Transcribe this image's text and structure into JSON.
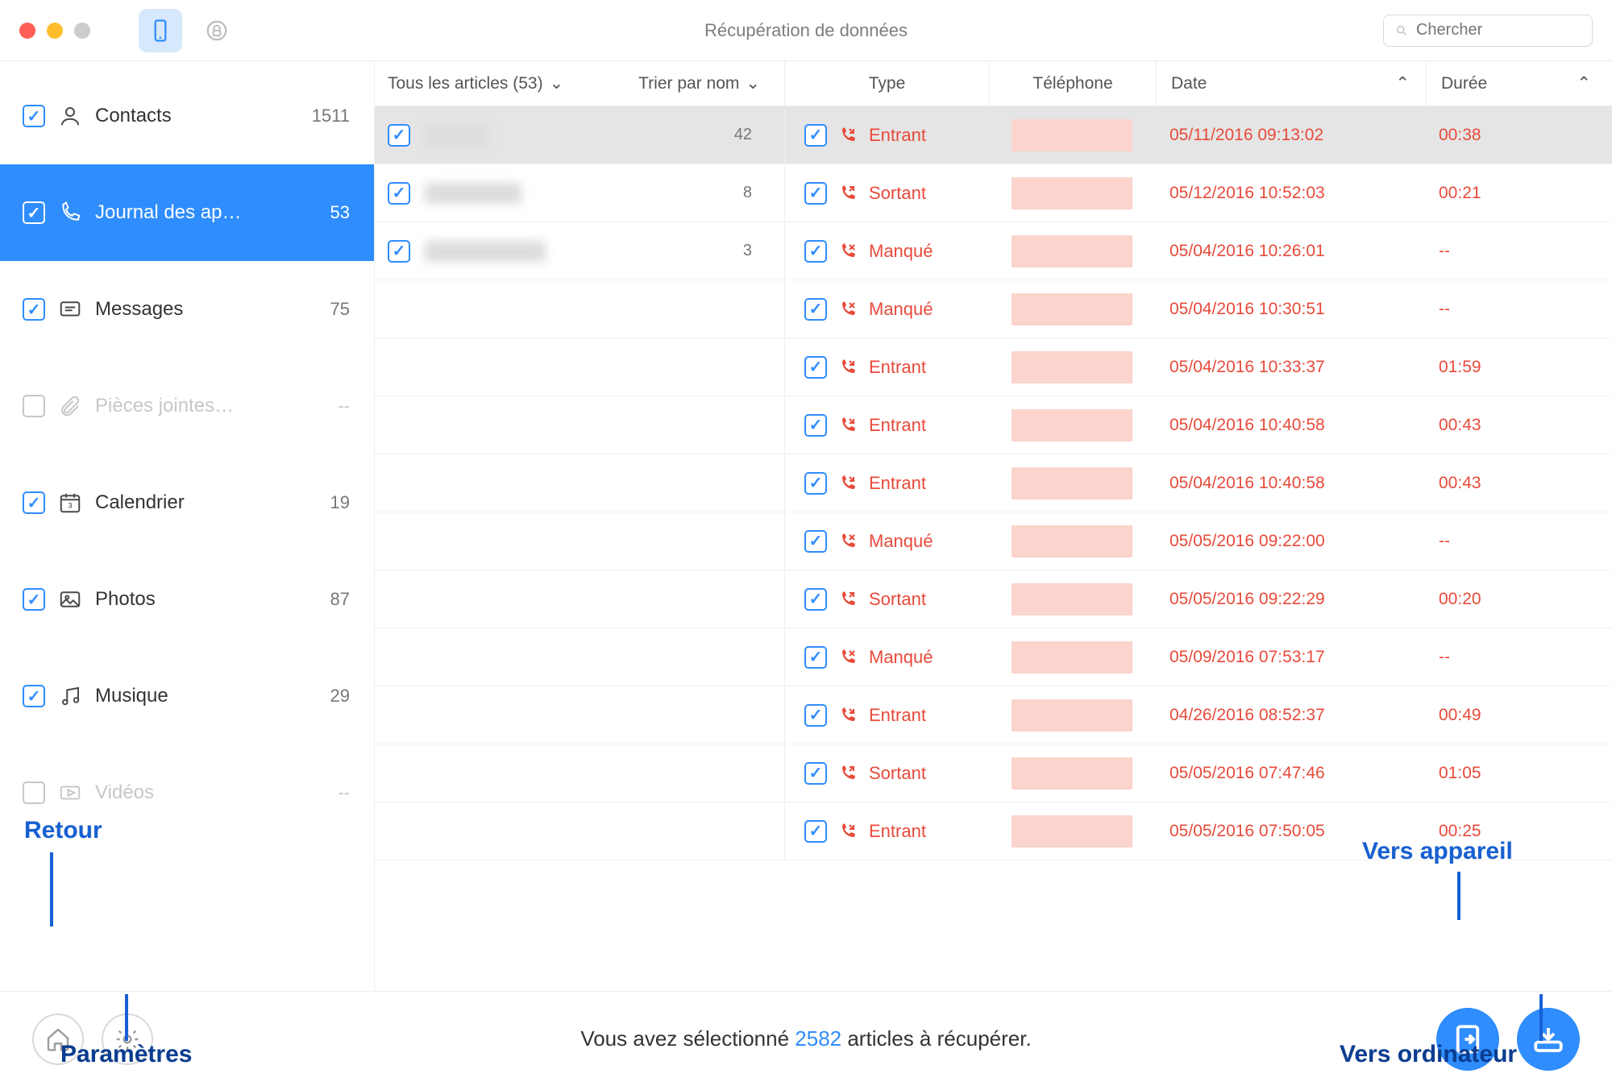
{
  "title": "Récupération de données",
  "search_placeholder": "Chercher",
  "sidebar": [
    {
      "label": "Contacts",
      "count": "1511",
      "enabled": true,
      "checked": true,
      "icon": "contacts"
    },
    {
      "label": "Journal des ap…",
      "count": "53",
      "enabled": true,
      "checked": true,
      "active": true,
      "icon": "calls"
    },
    {
      "label": "Messages",
      "count": "75",
      "enabled": true,
      "checked": true,
      "icon": "messages"
    },
    {
      "label": "Pièces jointes…",
      "count": "--",
      "enabled": false,
      "checked": false,
      "icon": "attachments"
    },
    {
      "label": "Calendrier",
      "count": "19",
      "enabled": true,
      "checked": true,
      "icon": "calendar"
    },
    {
      "label": "Photos",
      "count": "87",
      "enabled": true,
      "checked": true,
      "icon": "photos"
    },
    {
      "label": "Musique",
      "count": "29",
      "enabled": true,
      "checked": true,
      "icon": "music"
    },
    {
      "label": "Vidéos",
      "count": "--",
      "enabled": false,
      "checked": false,
      "icon": "videos"
    }
  ],
  "columns": {
    "articles": "Tous les articles (53)",
    "sort": "Trier par nom",
    "type": "Type",
    "phone": "Téléphone",
    "date": "Date",
    "duration": "Durée"
  },
  "name_rows": [
    {
      "selected": true,
      "blur_w": 78,
      "count": "42"
    },
    {
      "selected": false,
      "blur_w": 120,
      "count": "8"
    },
    {
      "selected": false,
      "blur_w": 150,
      "count": "3"
    }
  ],
  "call_types": {
    "entrant": "Entrant",
    "sortant": "Sortant",
    "manque": "Manqué"
  },
  "calls": [
    {
      "sel": true,
      "type": "entrant",
      "date": "05/11/2016 09:13:02",
      "dur": "00:38"
    },
    {
      "sel": false,
      "type": "sortant",
      "date": "05/12/2016 10:52:03",
      "dur": "00:21"
    },
    {
      "sel": false,
      "type": "manque",
      "date": "05/04/2016 10:26:01",
      "dur": "--"
    },
    {
      "sel": false,
      "type": "manque",
      "date": "05/04/2016 10:30:51",
      "dur": "--"
    },
    {
      "sel": false,
      "type": "entrant",
      "date": "05/04/2016 10:33:37",
      "dur": "01:59"
    },
    {
      "sel": false,
      "type": "entrant",
      "date": "05/04/2016 10:40:58",
      "dur": "00:43"
    },
    {
      "sel": false,
      "type": "entrant",
      "date": "05/04/2016 10:40:58",
      "dur": "00:43"
    },
    {
      "sel": false,
      "type": "manque",
      "date": "05/05/2016 09:22:00",
      "dur": "--"
    },
    {
      "sel": false,
      "type": "sortant",
      "date": "05/05/2016 09:22:29",
      "dur": "00:20"
    },
    {
      "sel": false,
      "type": "manque",
      "date": "05/09/2016 07:53:17",
      "dur": "--"
    },
    {
      "sel": false,
      "type": "entrant",
      "date": "04/26/2016 08:52:37",
      "dur": "00:49"
    },
    {
      "sel": false,
      "type": "sortant",
      "date": "05/05/2016 07:47:46",
      "dur": "01:05"
    },
    {
      "sel": false,
      "type": "entrant",
      "date": "05/05/2016 07:50:05",
      "dur": "00:25"
    }
  ],
  "footer": {
    "prefix": "Vous avez sélectionné ",
    "count": "2582",
    "suffix": " articles à récupérer."
  },
  "annotations": {
    "retour": "Retour",
    "parametres": "Paramètres",
    "vers_appareil": "Vers appareil",
    "vers_ordinateur": "Vers ordinateur"
  }
}
